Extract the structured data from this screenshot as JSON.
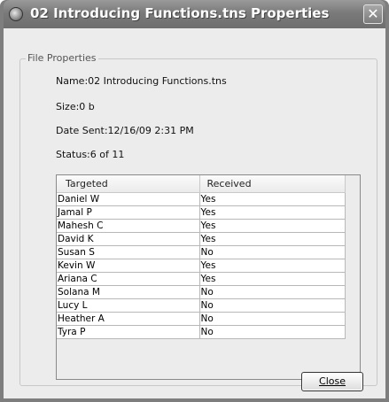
{
  "window": {
    "title": "02 Introducing Functions.tns Properties",
    "close_glyph": "✕"
  },
  "group": {
    "legend": "File Properties",
    "name_line": "Name:02 Introducing Functions.tns",
    "size_line": "Size:0 b",
    "date_line": "Date Sent:12/16/09 2:31 PM",
    "status_line": "Status:6 of 11"
  },
  "table": {
    "columns": [
      "Targeted",
      "Received"
    ],
    "rows": [
      [
        "Daniel W",
        "Yes"
      ],
      [
        "Jamal P",
        "Yes"
      ],
      [
        "Mahesh C",
        "Yes"
      ],
      [
        "David K",
        "Yes"
      ],
      [
        "Susan S",
        "No"
      ],
      [
        "Kevin W",
        "Yes"
      ],
      [
        "Ariana C",
        "Yes"
      ],
      [
        "Solana M",
        "No"
      ],
      [
        "Lucy L",
        "No"
      ],
      [
        "Heather A",
        "No"
      ],
      [
        "Tyra P",
        "No"
      ]
    ]
  },
  "buttons": {
    "close_label": "Close"
  },
  "colors": {
    "titlebar": "#7a7a7a",
    "client_bg": "#ececec"
  }
}
